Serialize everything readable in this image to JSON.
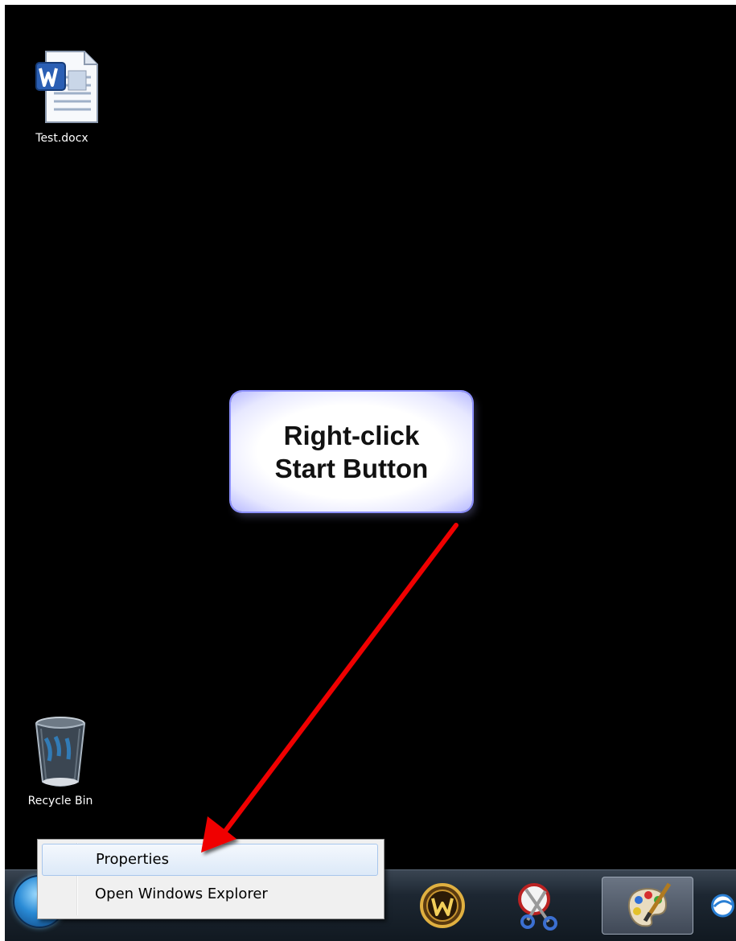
{
  "desktop": {
    "icons": [
      {
        "label": "Test.docx",
        "icon": "word-document-icon"
      },
      {
        "label": "Recycle Bin",
        "icon": "recycle-bin-icon"
      }
    ],
    "background_color": "#000000"
  },
  "annotation": {
    "callout_text": "Right-click\nStart Button",
    "arrow_color": "#ff0000"
  },
  "context_menu": {
    "items": [
      {
        "label": "Properties",
        "highlighted": true
      },
      {
        "label": "Open Windows Explorer",
        "highlighted": false
      }
    ]
  },
  "taskbar": {
    "start_button": "windows-start-orb-icon",
    "pinned_icons": [
      "world-of-warcraft-icon",
      "snipping-tool-icon",
      "paint-icon",
      "internet-explorer-icon"
    ],
    "active_icon": "paint-icon"
  }
}
